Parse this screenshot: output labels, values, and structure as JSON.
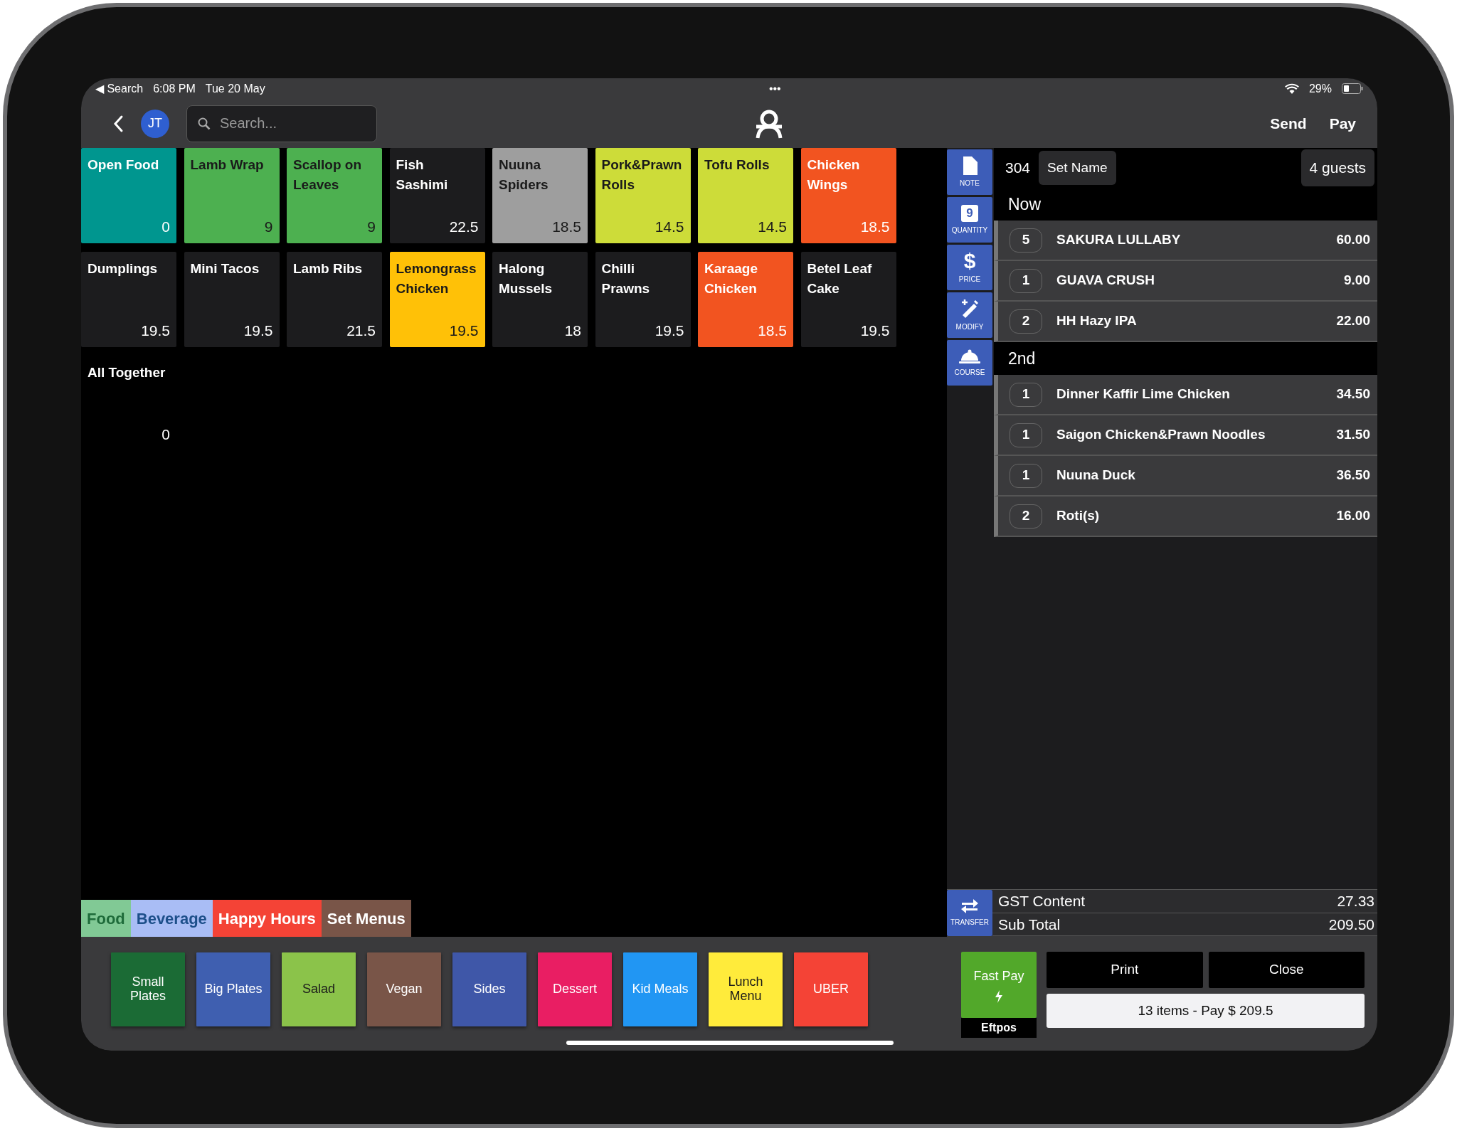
{
  "status_bar": {
    "back_app": "◀ Search",
    "time": "6:08 PM",
    "date": "Tue 20 May",
    "dots": "•••",
    "battery": "29%"
  },
  "nav": {
    "avatar": "JT",
    "search": {
      "placeholder": "Search..."
    },
    "actions": [
      "Send",
      "Pay"
    ]
  },
  "tiles": [
    {
      "name": "Open Food",
      "price": "0",
      "color": "#00968f"
    },
    {
      "name": "Lamb Wrap",
      "price": "9",
      "color": "#4db050"
    },
    {
      "name": "Scallop on Leaves",
      "price": "9",
      "color": "#4db050"
    },
    {
      "name": "Fish Sashimi",
      "price": "22.5",
      "color": "#1c1c1e"
    },
    {
      "name": "Nuuna Spiders",
      "price": "18.5",
      "color": "#9e9e9e"
    },
    {
      "name": "Pork&Prawn Rolls",
      "price": "14.5",
      "color": "#cddc39"
    },
    {
      "name": "Tofu Rolls",
      "price": "14.5",
      "color": "#cddc39"
    },
    {
      "name": "Chicken Wings",
      "price": "18.5",
      "color": "#f25420"
    },
    {
      "name": "Dumplings",
      "price": "19.5",
      "color": "#1c1c1e"
    },
    {
      "name": "Mini Tacos",
      "price": "19.5",
      "color": "#1c1c1e"
    },
    {
      "name": "Lamb Ribs",
      "price": "21.5",
      "color": "#1c1c1e"
    },
    {
      "name": "Lemongrass Chicken",
      "price": "19.5",
      "color": "#ffc107"
    },
    {
      "name": "Halong Mussels",
      "price": "18",
      "color": "#1c1c1e"
    },
    {
      "name": "Chilli Prawns",
      "price": "19.5",
      "color": "#1c1c1e"
    },
    {
      "name": "Karaage Chicken",
      "price": "18.5",
      "color": "#f25420"
    },
    {
      "name": "Betel Leaf Cake",
      "price": "19.5",
      "color": "#1c1c1e"
    },
    {
      "name": "All Together",
      "price": "0",
      "color": "#000000"
    }
  ],
  "menu_tabs": [
    {
      "label": "Food",
      "color": "#81c995"
    },
    {
      "label": "Beverage",
      "color": "#a9bdf5"
    },
    {
      "label": "Happy Hours",
      "color": "#f44336"
    },
    {
      "label": "Set Menus",
      "color": "#795548"
    }
  ],
  "categories": [
    {
      "label": "Small Plates",
      "color": "#1b6b35"
    },
    {
      "label": "Big Plates",
      "color": "#3f5fb0"
    },
    {
      "label": "Salad",
      "color": "#8bc34a"
    },
    {
      "label": "Vegan",
      "color": "#795548"
    },
    {
      "label": "Sides",
      "color": "#3f57a8"
    },
    {
      "label": "Dessert",
      "color": "#e91e63"
    },
    {
      "label": "Kid Meals",
      "color": "#2196f3"
    },
    {
      "label": "Lunch Menu",
      "color": "#ffeb3b"
    },
    {
      "label": "UBER",
      "color": "#f44336"
    }
  ],
  "order_actions": [
    {
      "kind": "note",
      "label": "NOTE"
    },
    {
      "kind": "quantity",
      "label": "QUANTITY",
      "glyph": "9"
    },
    {
      "kind": "price",
      "label": "PRICE",
      "glyph": "$"
    },
    {
      "kind": "modify",
      "label": "MODIFY"
    },
    {
      "kind": "course",
      "label": "COURSE"
    }
  ],
  "order": {
    "table": "304",
    "set_name": "Set Name",
    "guests": "4 guests",
    "courses": [
      {
        "name": "Now",
        "items": [
          {
            "qty": "5",
            "name": "SAKURA LULLABY",
            "price": "60.00"
          },
          {
            "qty": "1",
            "name": "GUAVA CRUSH",
            "price": "9.00"
          },
          {
            "qty": "2",
            "name": "HH Hazy IPA",
            "price": "22.00"
          }
        ]
      },
      {
        "name": "2nd",
        "items": [
          {
            "qty": "1",
            "name": "Dinner Kaffir Lime Chicken",
            "price": "34.50"
          },
          {
            "qty": "1",
            "name": "Saigon Chicken&Prawn Noodles",
            "price": "31.50"
          },
          {
            "qty": "1",
            "name": "Nuuna Duck",
            "price": "36.50"
          },
          {
            "qty": "2",
            "name": "Roti(s)",
            "price": "16.00"
          }
        ]
      }
    ]
  },
  "transfer": {
    "label": "TRANSFER"
  },
  "totals": [
    {
      "label": "GST Content",
      "value": "27.33"
    },
    {
      "label": "Sub Total",
      "value": "209.50"
    }
  ],
  "payment": {
    "fast_pay": "Fast Pay",
    "fast_pay_method": "Eftpos",
    "buttons": [
      "Print",
      "Close"
    ],
    "pay": "13 items - Pay $ 209.5"
  }
}
